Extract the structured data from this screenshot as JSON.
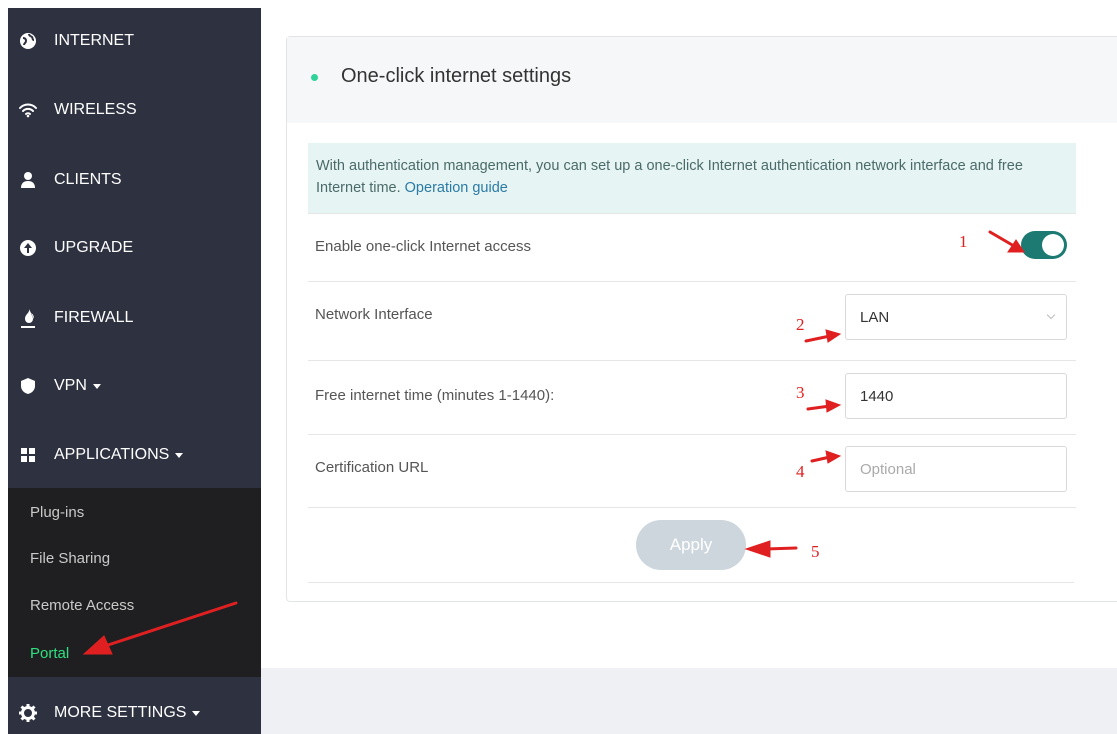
{
  "sidebar": {
    "items": [
      {
        "label": "INTERNET",
        "icon": "globe-icon"
      },
      {
        "label": "WIRELESS",
        "icon": "wifi-icon"
      },
      {
        "label": "CLIENTS",
        "icon": "user-icon"
      },
      {
        "label": "UPGRADE",
        "icon": "upgrade-icon"
      },
      {
        "label": "FIREWALL",
        "icon": "fire-icon"
      },
      {
        "label": "VPN",
        "icon": "shield-icon"
      },
      {
        "label": "APPLICATIONS",
        "icon": "grid-icon"
      },
      {
        "label": "MORE SETTINGS",
        "icon": "gear-icon"
      }
    ],
    "submenu": [
      {
        "label": "Plug-ins"
      },
      {
        "label": "File Sharing"
      },
      {
        "label": "Remote Access"
      },
      {
        "label": "Portal",
        "active": true
      }
    ]
  },
  "card": {
    "title": "One-click internet settings",
    "info_text": "With authentication management, you can set up a one-click Internet authentication network interface and free Internet time.",
    "info_link": "Operation guide",
    "enable_label": "Enable one-click Internet access",
    "enable_value": true,
    "network_label": "Network Interface",
    "network_value": "LAN",
    "free_time_label": "Free internet time (minutes 1-1440):",
    "free_time_value": "1440",
    "cert_label": "Certification URL",
    "cert_placeholder": "Optional",
    "apply_label": "Apply"
  },
  "annotations": [
    "1",
    "2",
    "3",
    "4",
    "5"
  ],
  "colors": {
    "sidebar_bg": "#2e3140",
    "submenu_bg": "#1f1f22",
    "active_green": "#2fe07f",
    "toggle_on": "#1c7a72",
    "annotation_red": "#e02020"
  }
}
